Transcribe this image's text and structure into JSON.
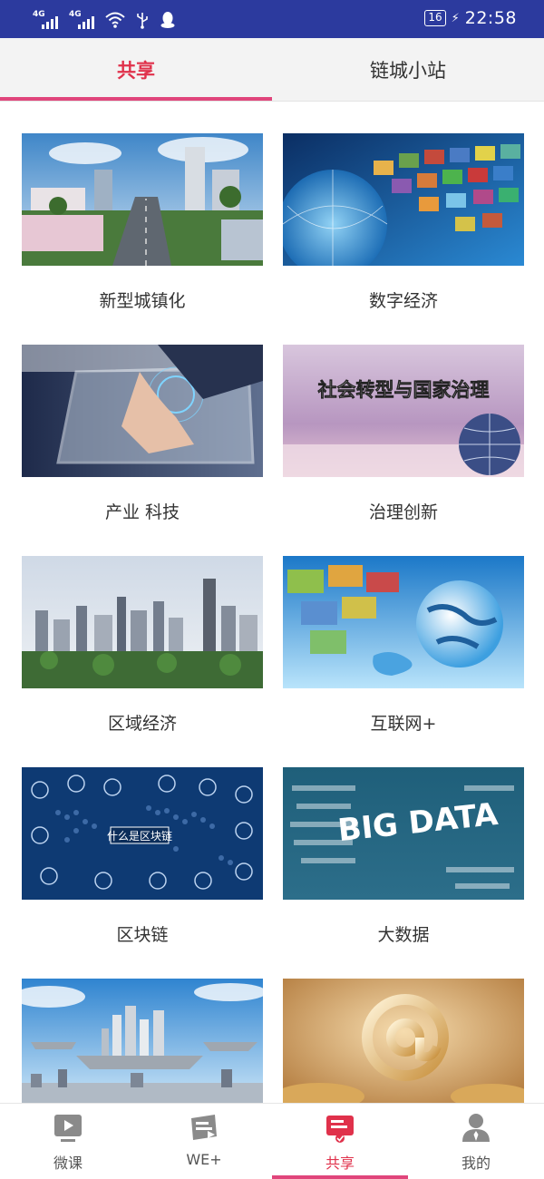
{
  "status_bar": {
    "network_1": "4G",
    "network_2": "4G",
    "battery": "16",
    "time": "22:58",
    "icons": [
      "signal-icon",
      "signal-icon",
      "wifi-icon",
      "usb-icon",
      "qq-icon",
      "battery-icon",
      "charging-icon"
    ]
  },
  "top_tabs": {
    "items": [
      {
        "label": "共享",
        "active": true
      },
      {
        "label": "链城小站",
        "active": false
      }
    ]
  },
  "grid": {
    "items": [
      {
        "label": "新型城镇化",
        "image": "city-street-photo"
      },
      {
        "label": "数字经济",
        "image": "digital-globe-photo"
      },
      {
        "label": "产业 科技",
        "image": "touchscreen-hand-photo"
      },
      {
        "label": "治理创新",
        "image": "governance-globe-photo",
        "image_text": "社会转型与国家治理"
      },
      {
        "label": "区域经济",
        "image": "city-skyline-photo"
      },
      {
        "label": "互联网+",
        "image": "internet-globe-photo"
      },
      {
        "label": "区块链",
        "image": "blockchain-map-photo",
        "image_text": "什么是区块链"
      },
      {
        "label": "大数据",
        "image": "big-data-words-photo",
        "image_text": "BIG DATA"
      },
      {
        "label": "",
        "image": "floating-city-photo"
      },
      {
        "label": "",
        "image": "at-sign-coins-photo"
      }
    ]
  },
  "bottom_nav": {
    "items": [
      {
        "label": "微课",
        "icon": "play-video-icon",
        "active": false
      },
      {
        "label": "WE+",
        "icon": "slides-icon",
        "active": false
      },
      {
        "label": "共享",
        "icon": "share-card-icon",
        "active": true
      },
      {
        "label": "我的",
        "icon": "user-icon",
        "active": false
      }
    ]
  },
  "colors": {
    "status_bar": "#2c3a9e",
    "accent": "#e0314b",
    "indicator": "#e0457b",
    "tab_bar_bg": "#f3f3f3"
  }
}
